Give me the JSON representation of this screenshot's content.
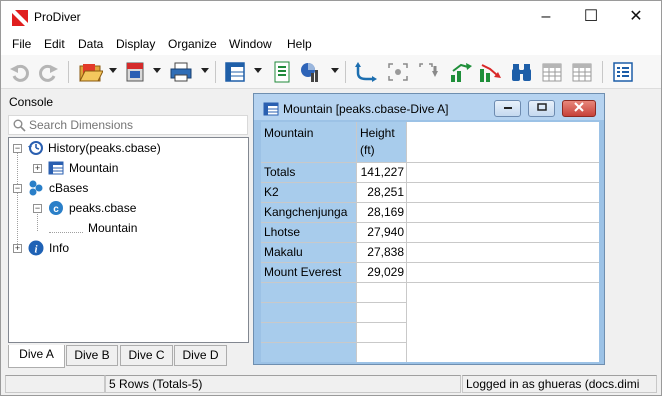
{
  "window": {
    "title": "ProDiver",
    "controls": {
      "minimize": "–",
      "maximize": "☐",
      "close": "✕"
    }
  },
  "menu": [
    "File",
    "Edit",
    "Data",
    "Display",
    "Organize",
    "Window",
    "Help"
  ],
  "toolbar": {
    "icons": [
      "undo-icon",
      "redo-icon",
      "open-folder-icon",
      "dive-book-icon",
      "print-icon",
      "table-view-icon",
      "report-icon",
      "chart-icon",
      "swap-axes-icon",
      "focus-icon",
      "drill-icon",
      "sort-ascending-icon",
      "sort-descending-icon",
      "binoculars-icon",
      "calendar-grid-icon",
      "grid-icon",
      "properties-icon"
    ]
  },
  "console": {
    "label": "Console",
    "search_placeholder": "Search Dimensions",
    "tree": {
      "history": "History(peaks.cbase)",
      "history_child": "Mountain",
      "cbases": "cBases",
      "cbase_item": "peaks.cbase",
      "cbase_child": "Mountain",
      "info": "Info"
    },
    "tabs": [
      "Dive A",
      "Dive B",
      "Dive C",
      "Dive D"
    ],
    "active_tab": "Dive A"
  },
  "dive_window": {
    "title": "Mountain [peaks.cbase-Dive A]",
    "headers": {
      "dimension": "Mountain",
      "measure_line1": "Height",
      "measure_line2": "(ft)"
    },
    "rows": [
      {
        "name": "Totals",
        "value": "141,227"
      },
      {
        "name": "K2",
        "value": "28,251"
      },
      {
        "name": "Kangchenjunga",
        "value": "28,169"
      },
      {
        "name": "Lhotse",
        "value": "27,940"
      },
      {
        "name": "Makalu",
        "value": "27,838"
      },
      {
        "name": "Mount Everest",
        "value": "29,029"
      }
    ]
  },
  "status": {
    "rows": "5 Rows (Totals-5)",
    "user": "Logged in as ghueras (docs.dimi"
  }
}
